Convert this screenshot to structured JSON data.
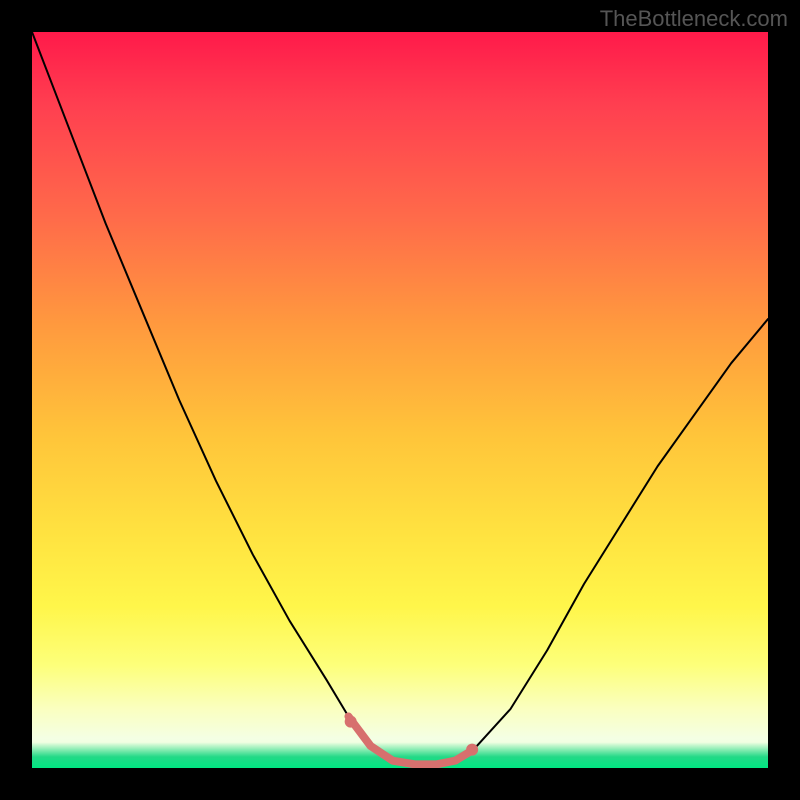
{
  "watermark": "TheBottleneck.com",
  "chart_data": {
    "type": "line",
    "title": "",
    "xlabel": "",
    "ylabel": "",
    "xlim": [
      0,
      100
    ],
    "ylim": [
      0,
      100
    ],
    "grid": false,
    "series": [
      {
        "name": "bottleneck-curve",
        "x": [
          0,
          5,
          10,
          15,
          20,
          25,
          30,
          35,
          40,
          43,
          46,
          49,
          52,
          55,
          57.5,
          60,
          65,
          70,
          75,
          80,
          85,
          90,
          95,
          100
        ],
        "values": [
          100,
          87,
          74,
          62,
          50,
          39,
          29,
          20,
          12,
          7,
          3,
          1,
          0.5,
          0.5,
          1,
          2.5,
          8,
          16,
          25,
          33,
          41,
          48,
          55,
          61
        ],
        "color": "#000000",
        "lineWidth": 2
      },
      {
        "name": "fit-region",
        "x": [
          43,
          46,
          49,
          52,
          55,
          57.5,
          60
        ],
        "values": [
          7,
          3,
          1,
          0.5,
          0.5,
          1,
          2.5
        ],
        "color": "#d7706e",
        "lineWidth": 8
      }
    ],
    "markers": [
      {
        "name": "fit-endpoint-left",
        "x": 43.3,
        "y": 6.3,
        "color": "#d7706e",
        "r": 6
      },
      {
        "name": "fit-endpoint-right",
        "x": 59.8,
        "y": 2.5,
        "color": "#d7706e",
        "r": 6
      }
    ],
    "gradient_stops": [
      {
        "pos": 0,
        "color": "#ff1a4a"
      },
      {
        "pos": 40,
        "color": "#ff9a3e"
      },
      {
        "pos": 70,
        "color": "#ffe240"
      },
      {
        "pos": 92,
        "color": "#faffc0"
      },
      {
        "pos": 100,
        "color": "#00e682"
      }
    ]
  }
}
